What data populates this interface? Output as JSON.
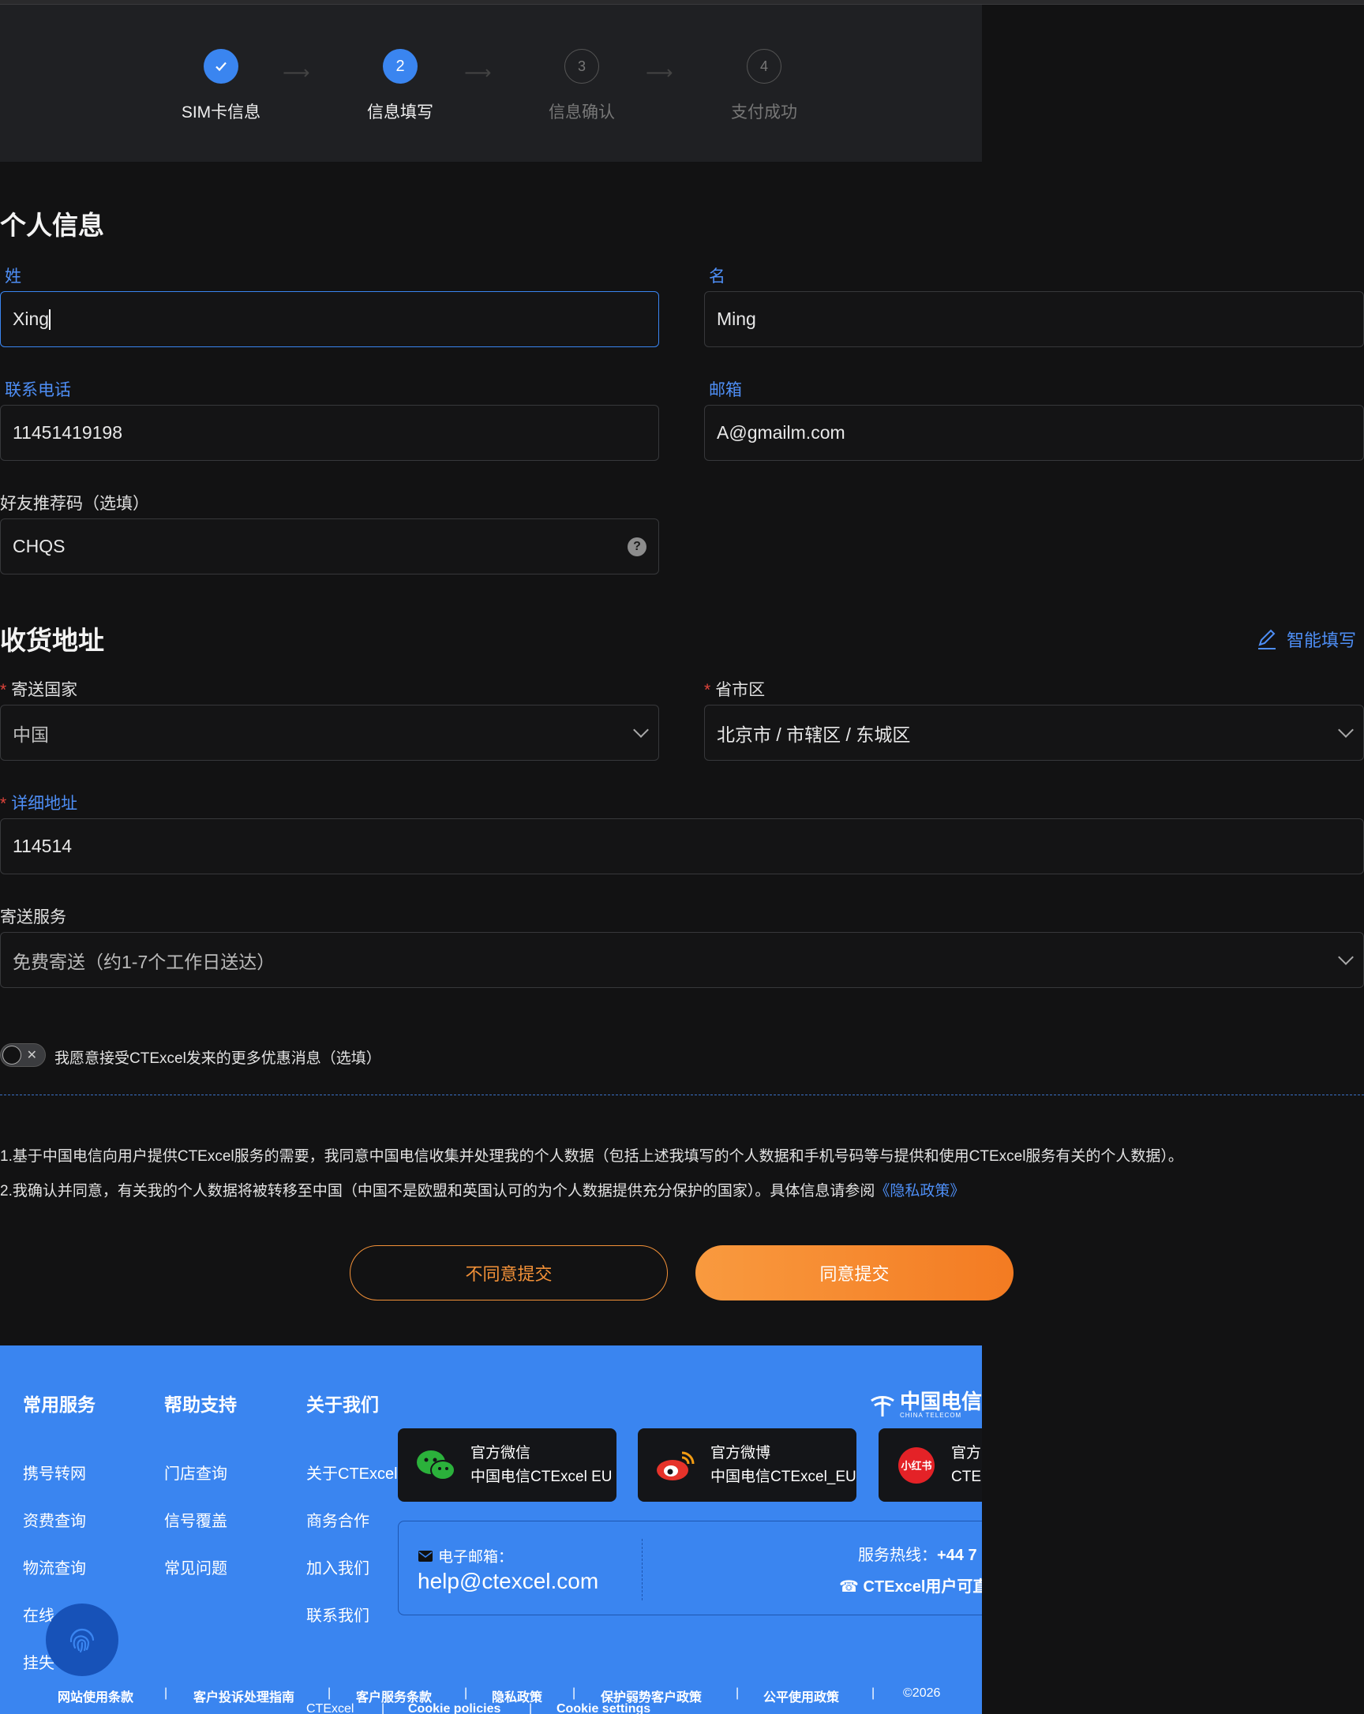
{
  "steps": [
    {
      "num": "✓",
      "label": "SIM卡信息"
    },
    {
      "num": "2",
      "label": "信息填写"
    },
    {
      "num": "3",
      "label": "信息确认"
    },
    {
      "num": "4",
      "label": "支付成功"
    }
  ],
  "personal": {
    "heading": "个人信息",
    "last_name_label": "姓",
    "last_name_value": "Xing",
    "first_name_label": "名",
    "first_name_value": "Ming",
    "phone_label": "联系电话",
    "phone_value": "11451419198",
    "email_label": "邮箱",
    "email_value": "A@gmailm.com",
    "referral_label": "好友推荐码（选填）",
    "referral_value": "CHQS",
    "help_glyph": "?"
  },
  "address": {
    "heading": "收货地址",
    "smart_fill": "智能填写",
    "country_label": "寄送国家",
    "country_value": "中国",
    "region_label": "省市区",
    "region_value": "北京市 / 市辖区 / 东城区",
    "detail_label": "详细地址",
    "detail_value": "114514",
    "shipping_label": "寄送服务",
    "shipping_value": "免费寄送（约1-7个工作日送达）"
  },
  "marketing_toggle": {
    "label": "我愿意接受CTExcel发来的更多优惠消息（选填）",
    "on": false
  },
  "consent": {
    "line1": "1.基于中国电信向用户提供CTExcel服务的需要，我同意中国电信收集并处理我的个人数据（包括上述我填写的个人数据和手机号码等与提供和使用CTExcel服务有关的个人数据）。",
    "line2": "2.我确认并同意，有关我的个人数据将被转移至中国（中国不是欧盟和英国认可的为个人数据提供充分保护的国家）。具体信息请参阅",
    "privacy_link": "《隐私政策》"
  },
  "buttons": {
    "disagree": "不同意提交",
    "agree": "同意提交"
  },
  "footer": {
    "col1": {
      "title": "常用服务",
      "items": [
        "携号转网",
        "资费查询",
        "物流查询",
        "在线",
        "挂失"
      ]
    },
    "col2": {
      "title": "帮助支持",
      "items": [
        "门店查询",
        "信号覆盖",
        "常见问题"
      ]
    },
    "col3": {
      "title": "关于我们",
      "items": [
        "关于CTExcel",
        "商务合作",
        "加入我们",
        "联系我们"
      ]
    },
    "logo_text": "中国电信",
    "logo_sub": "CHINA TELECOM",
    "wechat": {
      "title": "官方微信",
      "name": "中国电信CTExcel EU"
    },
    "weibo": {
      "title": "官方微博",
      "name": "中国电信CTExcel_EU"
    },
    "xhs": {
      "badge": "小红书",
      "title": "官方",
      "name": "CTE"
    },
    "email_label": "电子邮箱：",
    "email": "help@ctexcel.com",
    "hotline_label": "服务热线：",
    "hotline": "+44 7",
    "hotline_note": "CTExcel用户可直",
    "bottom_links": [
      "网站使用条款",
      "客户投诉处理指南",
      "客户服务条款",
      "隐私政策",
      "保护弱势客户政策",
      "公平使用政策"
    ],
    "copyright": "©2026",
    "bottom_links2": [
      "CTExcel",
      "Cookie policies",
      "Cookie settings"
    ]
  },
  "colors": {
    "accent": "#3a85f0",
    "orange": "#f37b22",
    "bg": "#121213"
  }
}
